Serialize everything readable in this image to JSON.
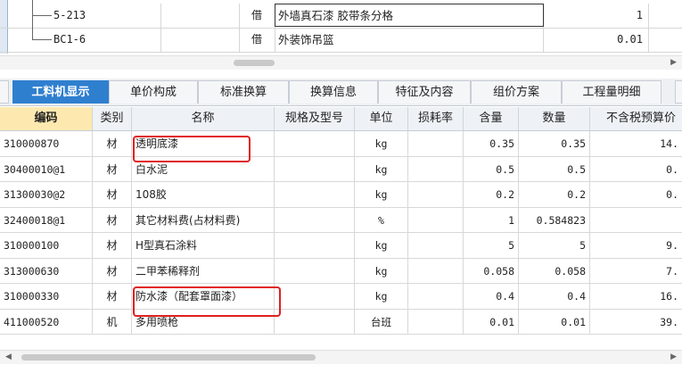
{
  "top_rows": [
    {
      "code": "5-213",
      "type": "借",
      "name": "外墙真石漆 胶带条分格",
      "qty": "1"
    },
    {
      "code": "BC1-6",
      "type": "借",
      "name": "外装饰吊篮",
      "qty": "0.01"
    }
  ],
  "tabs": [
    {
      "label": "工料机显示",
      "active": true
    },
    {
      "label": "单价构成"
    },
    {
      "label": "标准换算"
    },
    {
      "label": "换算信息"
    },
    {
      "label": "特征及内容"
    },
    {
      "label": "组价方案"
    },
    {
      "label": "工程量明细"
    }
  ],
  "grid": {
    "headers": {
      "code": "编码",
      "category": "类别",
      "name": "名称",
      "spec": "规格及型号",
      "unit": "单位",
      "loss": "损耗率",
      "content": "含量",
      "quantity": "数量",
      "price": "不含税预算价"
    },
    "rows": [
      {
        "code": "310000870",
        "category": "材",
        "name": "透明底漆",
        "spec": "",
        "unit": "kg",
        "loss": "",
        "content": "0.35",
        "quantity": "0.35",
        "price": "14."
      },
      {
        "code": "30400010@1",
        "category": "材",
        "name": "白水泥",
        "spec": "",
        "unit": "kg",
        "loss": "",
        "content": "0.5",
        "quantity": "0.5",
        "price": "0."
      },
      {
        "code": "31300030@2",
        "category": "材",
        "name": "108胶",
        "spec": "",
        "unit": "kg",
        "loss": "",
        "content": "0.2",
        "quantity": "0.2",
        "price": "0."
      },
      {
        "code": "32400018@1",
        "category": "材",
        "name": "其它材料费(占材料费)",
        "spec": "",
        "unit": "%",
        "loss": "",
        "content": "1",
        "quantity": "0.584823",
        "price": ""
      },
      {
        "code": "310000100",
        "category": "材",
        "name": "H型真石涂料",
        "spec": "",
        "unit": "kg",
        "loss": "",
        "content": "5",
        "quantity": "5",
        "price": "9."
      },
      {
        "code": "313000630",
        "category": "材",
        "name": "二甲苯稀释剂",
        "spec": "",
        "unit": "kg",
        "loss": "",
        "content": "0.058",
        "quantity": "0.058",
        "price": "7."
      },
      {
        "code": "310000330",
        "category": "材",
        "name": "防水漆（配套罩面漆）",
        "spec": "",
        "unit": "kg",
        "loss": "",
        "content": "0.4",
        "quantity": "0.4",
        "price": "16."
      },
      {
        "code": "411000520",
        "category": "机",
        "name": "多用喷枪",
        "spec": "",
        "unit": "台班",
        "loss": "",
        "content": "0.01",
        "quantity": "0.01",
        "price": "39."
      }
    ]
  },
  "highlight_color": "#e02020",
  "active_tab_color": "#2f7fcf",
  "icons": {
    "scroll_right": "▶",
    "scroll_left": "◀"
  }
}
